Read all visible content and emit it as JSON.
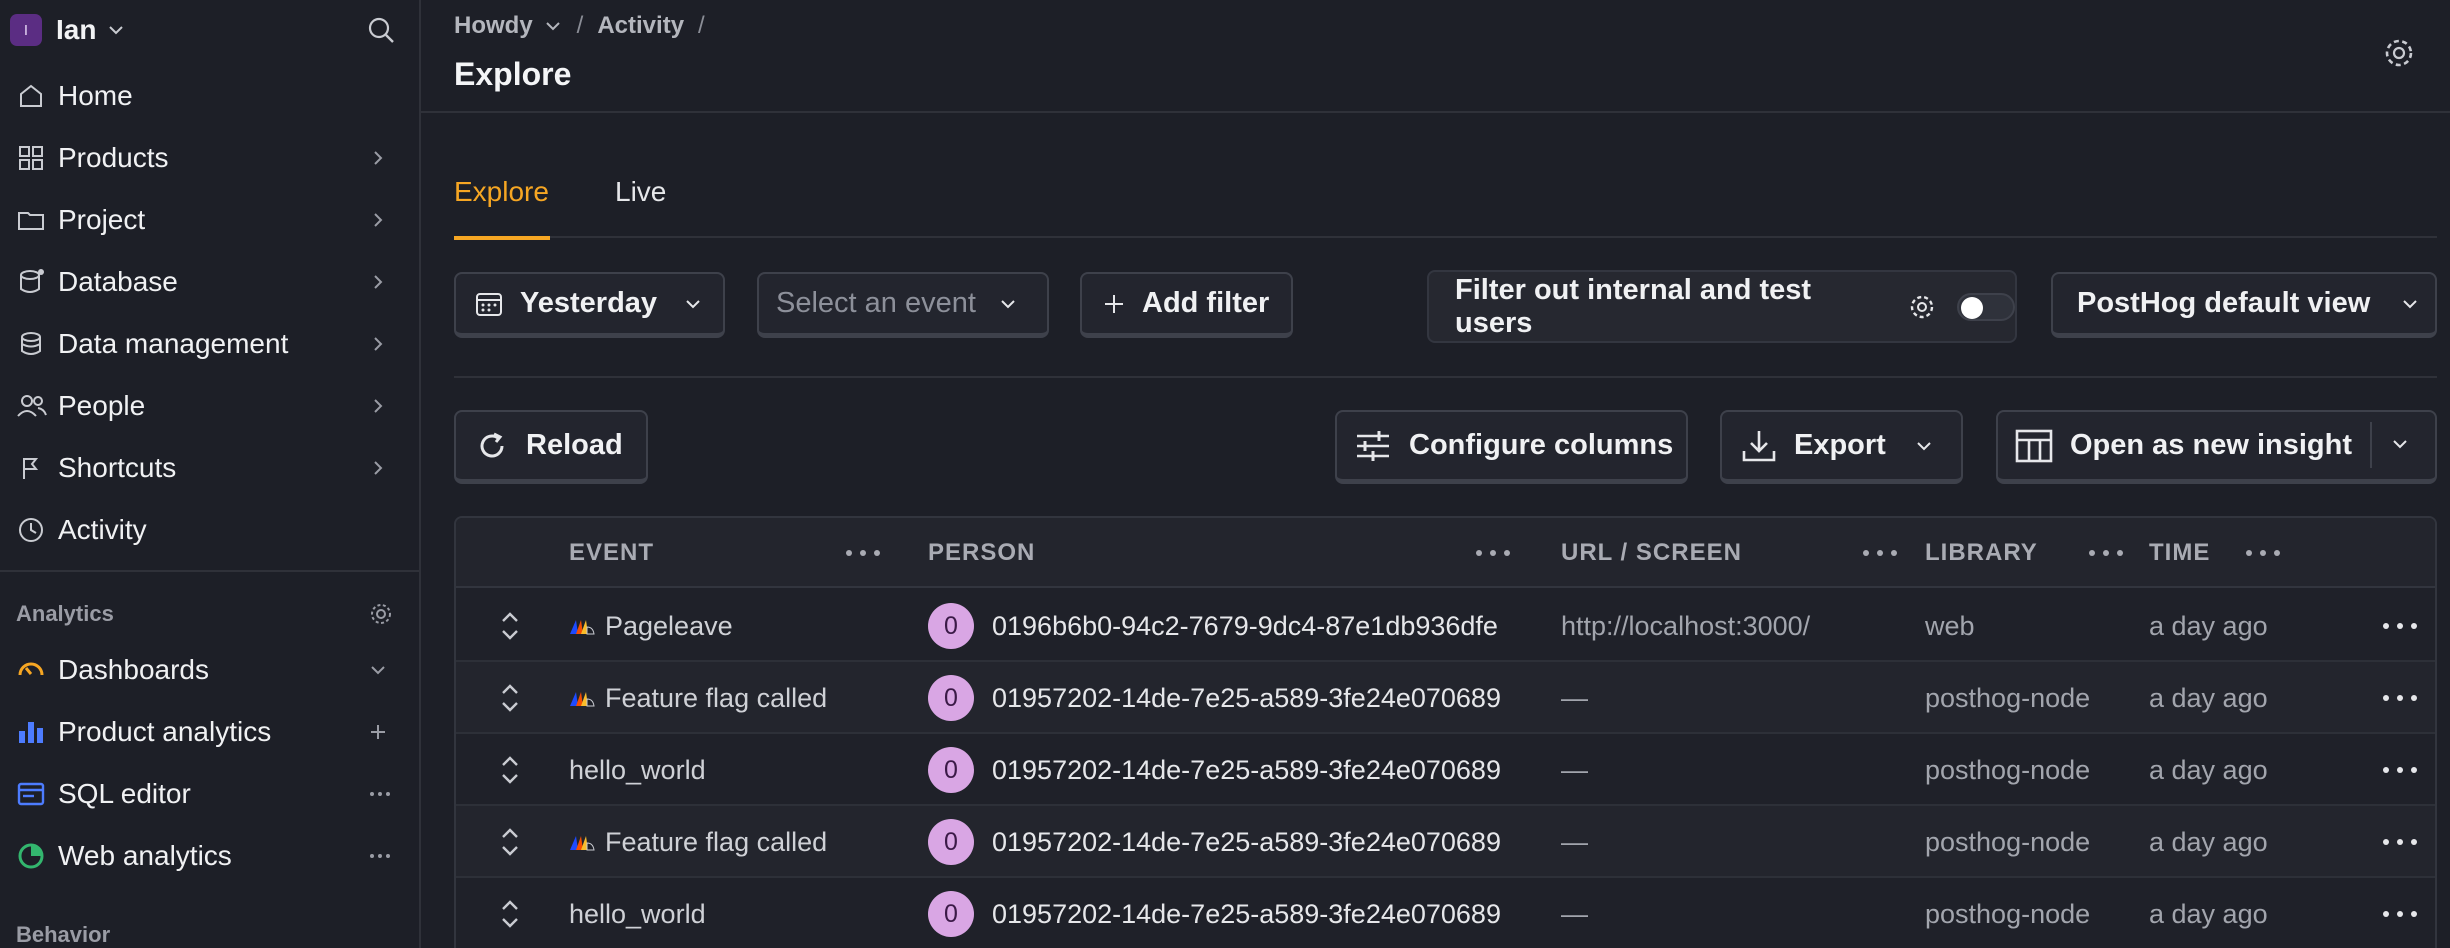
{
  "workspace": {
    "initial": "I",
    "name": "Ian"
  },
  "nav": [
    {
      "label": "Home",
      "icon": "home-icon"
    },
    {
      "label": "Products",
      "icon": "grid-icon"
    },
    {
      "label": "Project",
      "icon": "folder-icon"
    },
    {
      "label": "Database",
      "icon": "database-icon"
    },
    {
      "label": "Data management",
      "icon": "data-management-icon"
    },
    {
      "label": "People",
      "icon": "people-icon"
    },
    {
      "label": "Shortcuts",
      "icon": "shortcut-icon"
    },
    {
      "label": "Activity",
      "icon": "clock-icon"
    }
  ],
  "analytics": {
    "title": "Analytics",
    "items": [
      {
        "label": "Dashboards",
        "icon": "dashboard-icon",
        "color": "#f6a623"
      },
      {
        "label": "Product analytics",
        "icon": "bar-chart-icon",
        "color": "#4d7cff"
      },
      {
        "label": "SQL editor",
        "icon": "sql-icon",
        "color": "#4d7cff"
      },
      {
        "label": "Web analytics",
        "icon": "pie-icon",
        "color": "#33b66e"
      }
    ]
  },
  "behavior": {
    "title": "Behavior"
  },
  "breadcrumb": {
    "project": "Howdy",
    "section": "Activity",
    "sep": "/"
  },
  "page": {
    "title": "Explore"
  },
  "tabs": [
    {
      "label": "Explore"
    },
    {
      "label": "Live"
    }
  ],
  "toolbar": {
    "date": "Yesterday",
    "event_placeholder": "Select an event",
    "add_filter": "Add filter",
    "filter_internal": "Filter out internal and test users",
    "view": "PostHog default view",
    "reload": "Reload",
    "configure": "Configure columns",
    "export": "Export",
    "open_insight": "Open as new insight"
  },
  "table": {
    "columns": [
      "EVENT",
      "PERSON",
      "URL / SCREEN",
      "LIBRARY",
      "TIME"
    ],
    "rows": [
      {
        "event": "Pageleave",
        "posthog_icon": true,
        "person_initial": "0",
        "person": "0196b6b0-94c2-7679-9dc4-87e1db936dfe",
        "url": "http://localhost:3000/",
        "library": "web",
        "time": "a day ago"
      },
      {
        "event": "Feature flag called",
        "posthog_icon": true,
        "person_initial": "0",
        "person": "01957202-14de-7e25-a589-3fe24e070689",
        "url": "—",
        "library": "posthog-node",
        "time": "a day ago"
      },
      {
        "event": "hello_world",
        "posthog_icon": false,
        "person_initial": "0",
        "person": "01957202-14de-7e25-a589-3fe24e070689",
        "url": "—",
        "library": "posthog-node",
        "time": "a day ago"
      },
      {
        "event": "Feature flag called",
        "posthog_icon": true,
        "person_initial": "0",
        "person": "01957202-14de-7e25-a589-3fe24e070689",
        "url": "—",
        "library": "posthog-node",
        "time": "a day ago"
      },
      {
        "event": "hello_world",
        "posthog_icon": false,
        "person_initial": "0",
        "person": "01957202-14de-7e25-a589-3fe24e070689",
        "url": "—",
        "library": "posthog-node",
        "time": "a day ago"
      }
    ]
  },
  "colors": {
    "accent": "#f6a623",
    "background": "#1d1f27",
    "avatar_person": "#d9a6e4"
  }
}
